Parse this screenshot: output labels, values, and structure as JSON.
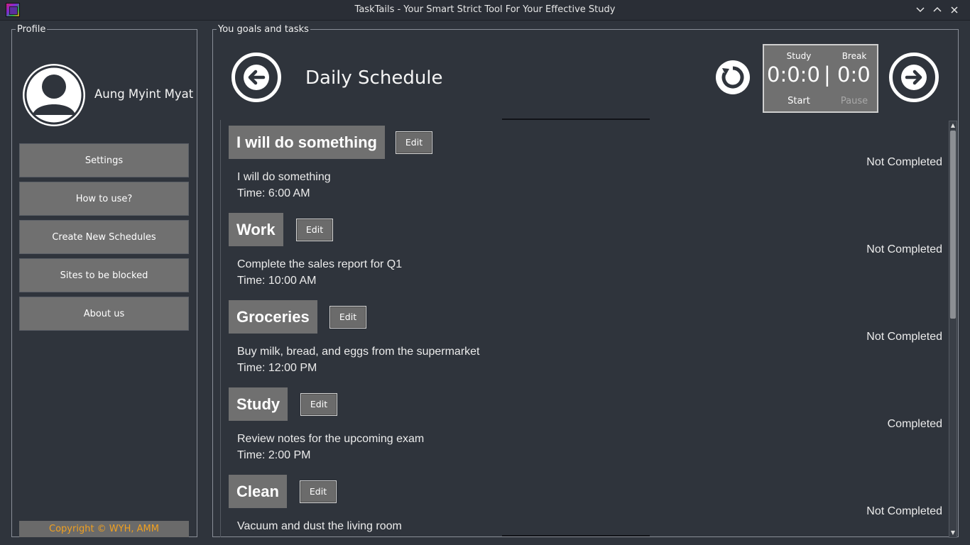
{
  "window": {
    "title": "TaskTails - Your Smart Strict Tool For Your Effective Study"
  },
  "profile": {
    "legend": "Profile",
    "username": "Aung Myint Myat",
    "menu": [
      {
        "label": "Settings"
      },
      {
        "label": "How to use?"
      },
      {
        "label": "Create New Schedules"
      },
      {
        "label": "Sites to be blocked"
      },
      {
        "label": "About us"
      }
    ],
    "copyright": "Copyright © WYH, AMM"
  },
  "main": {
    "legend": "You goals and tasks",
    "page_title": "Daily Schedule",
    "timer": {
      "study_label": "Study",
      "break_label": "Break",
      "study_value": "0:0:0",
      "separator": "|",
      "break_value": "0:0",
      "start_label": "Start",
      "pause_label": "Pause"
    },
    "edit_label": "Edit",
    "tasks": [
      {
        "title": "I will do something",
        "description": "I will do something",
        "time": "Time: 6:00 AM",
        "status": "Not Completed"
      },
      {
        "title": "Work",
        "description": "Complete the sales report for Q1",
        "time": "Time: 10:00 AM",
        "status": "Not Completed"
      },
      {
        "title": "Groceries",
        "description": "Buy milk, bread, and eggs from the supermarket",
        "time": "Time: 12:00 PM",
        "status": "Not Completed"
      },
      {
        "title": "Study",
        "description": "Review notes for the upcoming exam",
        "time": "Time: 2:00 PM",
        "status": "Completed"
      },
      {
        "title": "Clean",
        "description": "Vacuum and dust the living room",
        "time": "",
        "status": "Not Completed"
      }
    ]
  },
  "colors": {
    "background": "#2f343c",
    "button_gray": "#707070",
    "copyright_text": "#f0a020",
    "text": "#ffffff"
  },
  "icons": {
    "app": "tasktails-app-icon",
    "back": "arrow-left-circle-icon",
    "forward": "arrow-right-circle-icon",
    "reset": "reset-timer-icon",
    "avatar": "user-avatar-icon"
  }
}
